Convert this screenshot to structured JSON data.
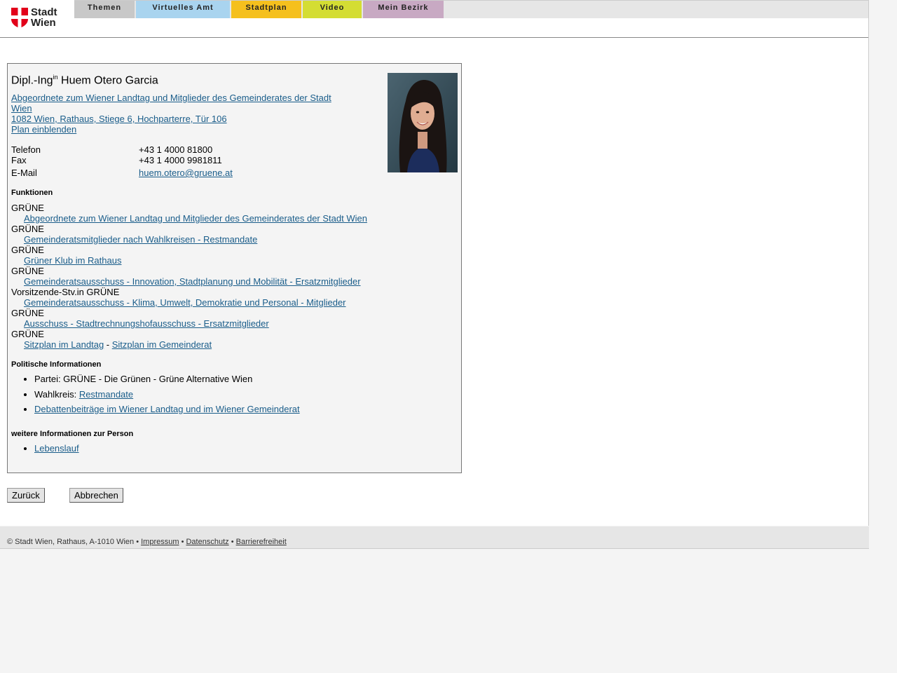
{
  "logo": {
    "line1": "Stadt",
    "line2": "Wien"
  },
  "nav": {
    "tabs": [
      {
        "label": "Themen",
        "color": "#c8c8c8"
      },
      {
        "label": "Virtuelles Amt",
        "color": "#a9d4ef"
      },
      {
        "label": "Stadtplan",
        "color": "#f5c01d"
      },
      {
        "label": "Video",
        "color": "#d4dd33"
      },
      {
        "label": "Mein Bezirk",
        "color": "#c8a9c3"
      }
    ]
  },
  "person": {
    "title_prefix": "Dipl.-Ing",
    "title_sup": "in",
    "name": "Huem Otero Garcia",
    "role_line1": "Abgeordnete zum Wiener Landtag und Mitglieder des Gemeinderates der Stadt",
    "role_line2": "Wien",
    "address": "1082 Wien, Rathaus, Stiege 6, Hochparterre, Tür 106",
    "plan_link": "Plan einblenden"
  },
  "contact": {
    "phone_label": "Telefon",
    "phone": "+43 1 4000 81800",
    "fax_label": "Fax",
    "fax": "+43 1 4000 9981811",
    "email_label": "E-Mail",
    "email": "huem.otero@gruene.at"
  },
  "functions": {
    "heading": "Funktionen",
    "items": [
      {
        "party": "GRÜNE",
        "link": "Abgeordnete zum Wiener Landtag und Mitglieder des Gemeinderates der Stadt Wien"
      },
      {
        "party": "GRÜNE",
        "link": "Gemeinderatsmitglieder nach Wahlkreisen - Restmandate"
      },
      {
        "party": "GRÜNE",
        "link": "Grüner Klub im Rathaus"
      },
      {
        "party": "GRÜNE",
        "link": "Gemeinderatsausschuss - Innovation, Stadtplanung und Mobilität - Ersatzmitglieder"
      },
      {
        "party": "Vorsitzende-Stv.in GRÜNE",
        "link": "Gemeinderatsausschuss - Klima, Umwelt, Demokratie und Personal - Mitglieder"
      },
      {
        "party": "GRÜNE",
        "link": "Ausschuss - Stadtrechnungshofausschuss - Ersatzmitglieder"
      },
      {
        "party": "GRÜNE",
        "link": "Sitzplan im Landtag",
        "sep": " - ",
        "link2": "Sitzplan im Gemeinderat"
      }
    ]
  },
  "political": {
    "heading": "Politische Informationen",
    "party_text": "Partei: GRÜNE - Die Grünen - Grüne Alternative Wien",
    "wahlkreis_label": "Wahlkreis: ",
    "wahlkreis_link": "Restmandate",
    "debate_link": "Debattenbeiträge im Wiener Landtag und im Wiener Gemeinderat"
  },
  "more": {
    "heading": "weitere Informationen zur Person",
    "cv_link": "Lebenslauf"
  },
  "buttons": {
    "back": "Zurück",
    "cancel": "Abbrechen"
  },
  "footer": {
    "copyright": "© Stadt Wien, Rathaus, A-1010 Wien",
    "bullet": " • ",
    "impressum": "Impressum",
    "datenschutz": "Datenschutz",
    "barrierefreiheit": "Barrierefreiheit"
  }
}
